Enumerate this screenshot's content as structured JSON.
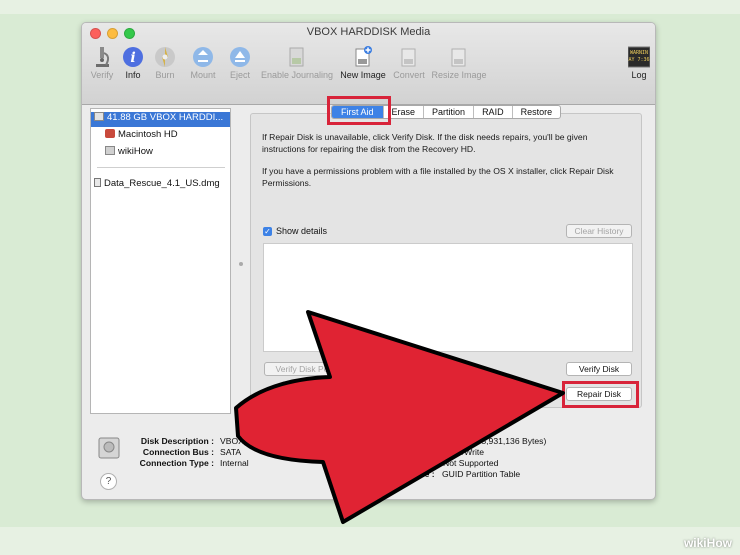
{
  "window": {
    "title": "VBOX HARDDISK Media"
  },
  "toolbar": {
    "items": [
      {
        "label": "Verify",
        "icon": "microscope-icon",
        "enabled": false
      },
      {
        "label": "Info",
        "icon": "info-icon",
        "enabled": true
      },
      {
        "label": "Burn",
        "icon": "burn-disc-icon",
        "enabled": false
      },
      {
        "label": "Mount",
        "icon": "mount-icon",
        "enabled": false
      },
      {
        "label": "Eject",
        "icon": "eject-icon",
        "enabled": false
      },
      {
        "label": "Enable Journaling",
        "icon": "journaling-icon",
        "enabled": false
      },
      {
        "label": "New Image",
        "icon": "new-image-icon",
        "enabled": true
      },
      {
        "label": "Convert",
        "icon": "convert-icon",
        "enabled": false
      },
      {
        "label": "Resize Image",
        "icon": "resize-image-icon",
        "enabled": false
      }
    ],
    "log": {
      "label": "Log",
      "icon_text_1": "WARNIN",
      "icon_text_2": "AY 7:36"
    }
  },
  "sidebar": {
    "items": [
      {
        "label": "41.88 GB VBOX HARDDI...",
        "selected": true,
        "icon": "hard-disk-icon"
      },
      {
        "label": "Macintosh HD",
        "selected": false,
        "icon": "volume-icon"
      },
      {
        "label": "wikiHow",
        "selected": false,
        "icon": "volume-icon"
      },
      {
        "label": "Data_Rescue_4.1_US.dmg",
        "selected": false,
        "icon": "disk-image-icon"
      }
    ]
  },
  "tabs": [
    "First Aid",
    "Erase",
    "Partition",
    "RAID",
    "Restore"
  ],
  "first_aid": {
    "para1": "If Repair Disk is unavailable, click Verify Disk. If the disk needs repairs, you'll be given instructions for repairing the disk from the Recovery HD.",
    "para2": "If you have a permissions problem with a file installed by the OS X installer, click Repair Disk Permissions.",
    "show_details": "Show details",
    "show_details_checked": true,
    "clear_history": "Clear History",
    "verify_permissions": "Verify Disk Permis",
    "verify_disk": "Verify Disk",
    "repair_disk": "Repair Disk"
  },
  "info": {
    "left": [
      {
        "label": "Disk Description :",
        "value": "VBOX HARDDISK Media"
      },
      {
        "label": "Connection Bus :",
        "value": "SATA"
      },
      {
        "label": "Connection Type :",
        "value": "Internal"
      }
    ],
    "right": [
      {
        "value": "(41,875,931,136 Bytes)"
      },
      {
        "value": "d/Write"
      },
      {
        "value": "Not Supported"
      },
      {
        "prefix": "R",
        "label": "me :",
        "value": "GUID Partition Table"
      }
    ]
  },
  "help": "?",
  "watermark": {
    "wiki": "wiki",
    "how": "How"
  },
  "colors": {
    "accent": "#3d82e6",
    "highlight": "#d8243a",
    "arrow": "#e02333"
  }
}
